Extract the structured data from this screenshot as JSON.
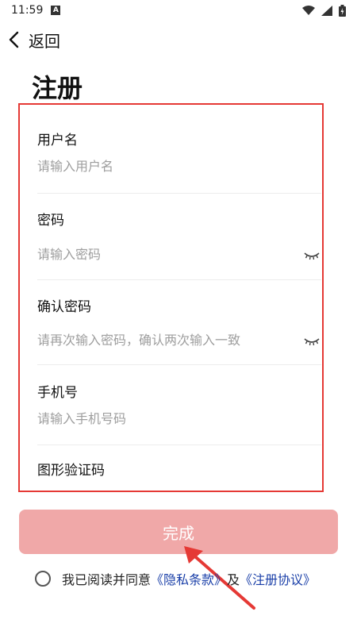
{
  "status_bar": {
    "time": "11:59",
    "notif_icon": "A"
  },
  "nav": {
    "back_label": "返回"
  },
  "page": {
    "title": "注册"
  },
  "form": {
    "username": {
      "label": "用户名",
      "placeholder": "请输入用户名"
    },
    "password": {
      "label": "密码",
      "placeholder": "请输入密码"
    },
    "confirm": {
      "label": "确认密码",
      "placeholder": "请再次输入密码，确认两次输入一致"
    },
    "phone": {
      "label": "手机号",
      "placeholder": "请输入手机号码"
    },
    "captcha": {
      "label": "图形验证码"
    }
  },
  "submit": {
    "label": "完成"
  },
  "agreement": {
    "prefix": "我已阅读并同意",
    "privacy_link": "《隐私条款》",
    "conjunction": "及",
    "register_link": "《注册协议》"
  },
  "colors": {
    "highlight_box": "#e53935",
    "button_bg": "#f0a8a8",
    "link": "#1a3fa8"
  }
}
